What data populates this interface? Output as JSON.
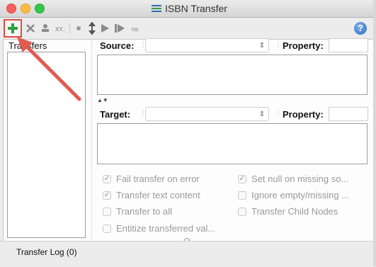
{
  "window": {
    "title": "ISBN Transfer"
  },
  "toolbar": {
    "xy_label": "XY..",
    "ns_label": "ns:",
    "icons": [
      "plus-icon",
      "delete-icon",
      "stamp-icon",
      "xy-icon",
      "dot-icon",
      "mapping-icon",
      "play-icon",
      "step-icon",
      "ns-icon",
      "help-icon"
    ]
  },
  "transfers": {
    "label": "Transfers"
  },
  "source": {
    "label": "Source:",
    "property_label": "Property:"
  },
  "target": {
    "label": "Target:",
    "property_label": "Property:"
  },
  "options": {
    "fail_on_error": {
      "label": "Fail transfer on error",
      "checked": true
    },
    "set_null_missing": {
      "label": "Set null on missing so...",
      "checked": true
    },
    "transfer_text": {
      "label": "Transfer text content",
      "checked": true
    },
    "ignore_empty": {
      "label": "Ignore empty/missing ...",
      "checked": false
    },
    "transfer_all": {
      "label": "Transfer to all",
      "checked": false
    },
    "transfer_child": {
      "label": "Transfer Child Nodes",
      "checked": false
    },
    "entitize": {
      "label": "Entitize transferred val...",
      "checked": false
    }
  },
  "log": {
    "label": "Transfer Log (0)"
  },
  "colors": {
    "accent_red": "#e04c45",
    "add_green": "#2e9e3a"
  }
}
